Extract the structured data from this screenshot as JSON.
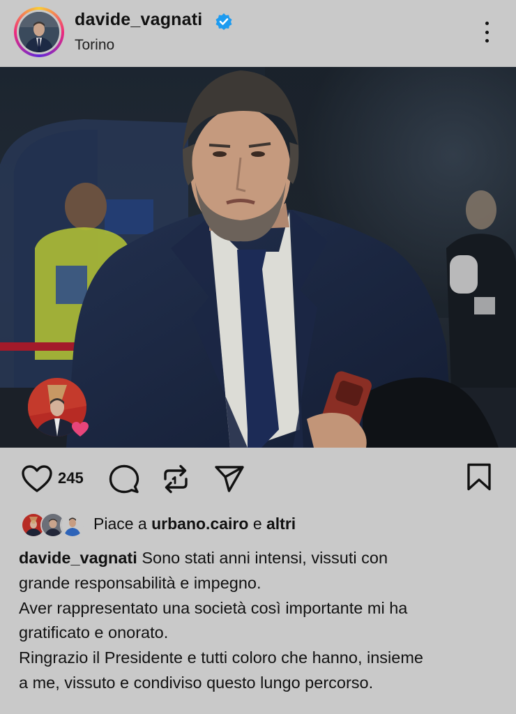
{
  "post": {
    "username": "davide_vagnati",
    "verified": true,
    "location": "Torino"
  },
  "actions": {
    "like_count": "245",
    "icons": [
      "heart-icon",
      "comment-icon",
      "repost-icon",
      "share-icon",
      "bookmark-icon"
    ]
  },
  "likes": {
    "prefix": "Piace a",
    "user": "urbano.cairo",
    "conjunction": "e",
    "others": "altri"
  },
  "caption": {
    "username": "davide_vagnati",
    "line1": "Sono stati anni intensi, vissuti con",
    "line2": "grande responsabilità e impegno.",
    "line3": "Aver rappresentato una società così importante mi ha",
    "line4": "gratificato e onorato.",
    "line5": "Ringrazio il Presidente e tutti coloro che hanno, insieme",
    "line6": "a me, vissuto e condiviso questo lungo percorso."
  },
  "colors": {
    "background": "#c9c9c9",
    "verified": "#1d9bf0",
    "music_heart": "#e8457a"
  }
}
